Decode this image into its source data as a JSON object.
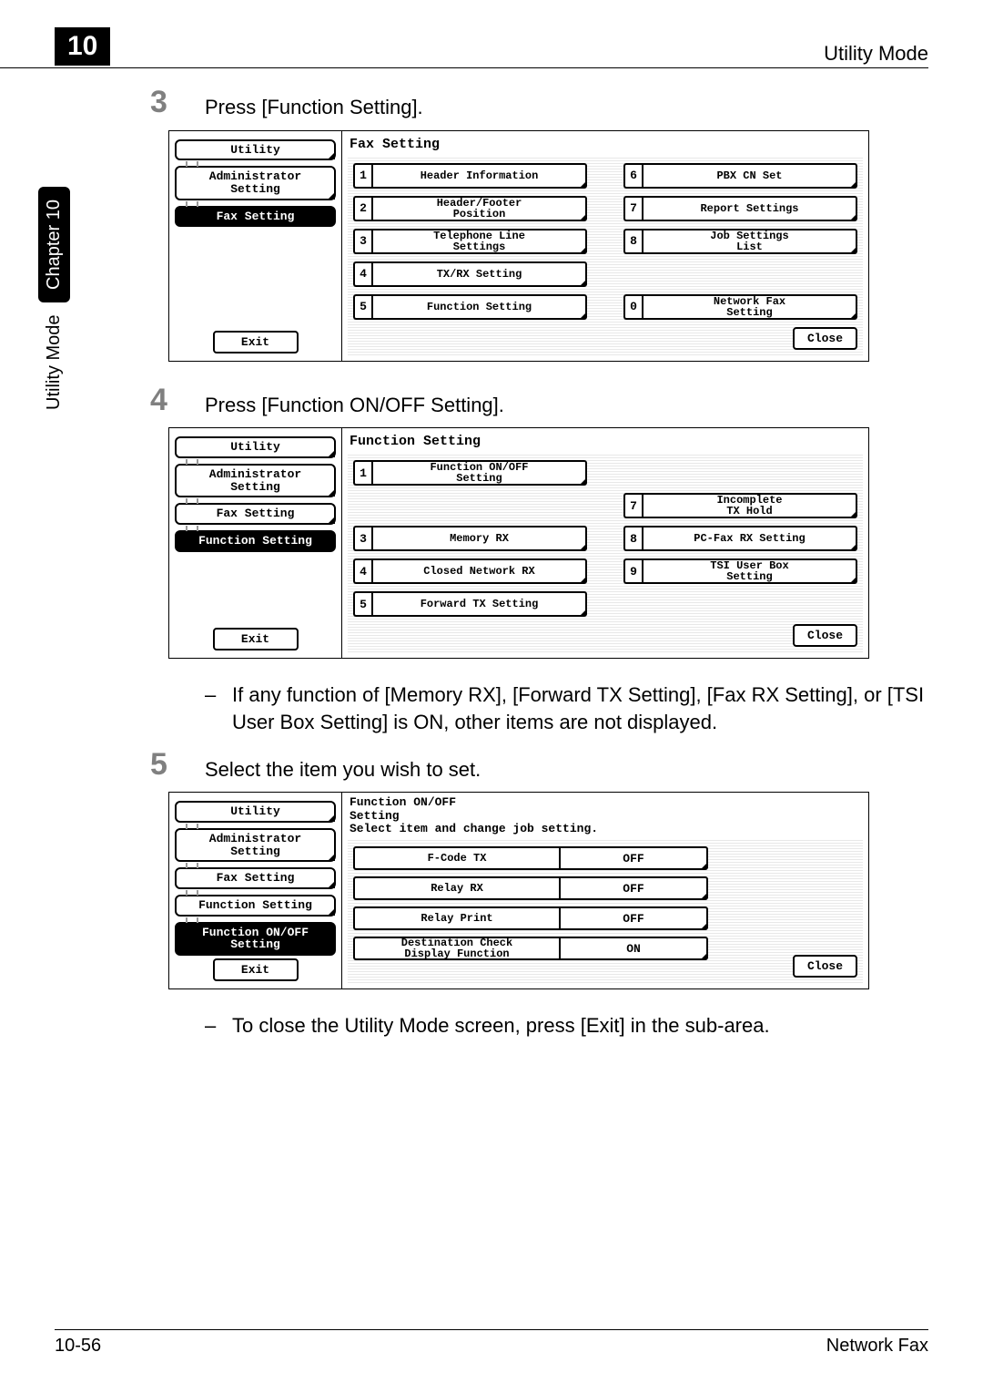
{
  "page": {
    "chapter_number": "10",
    "header_title": "Utility Mode",
    "side_label": "Utility Mode",
    "side_chapter": "Chapter 10",
    "footer_left": "10-56",
    "footer_right": "Network Fax"
  },
  "steps": {
    "s3": {
      "num": "3",
      "text": "Press [Function Setting]."
    },
    "s4": {
      "num": "4",
      "text": "Press [Function ON/OFF Setting]."
    },
    "note4": "If any function of [Memory RX], [Forward TX Setting], [Fax RX Setting], or [TSI User Box Setting] is ON, other items are not displayed.",
    "s5": {
      "num": "5",
      "text": "Select the item you wish to set."
    },
    "note5": "To close the Utility Mode screen, press [Exit] in the sub-area."
  },
  "screen1": {
    "title": "Fax Setting",
    "crumbs": [
      "Utility",
      "Administrator\nSetting",
      "Fax Setting"
    ],
    "exit": "Exit",
    "close": "Close",
    "opts": [
      {
        "n": "1",
        "label": "Header Information",
        "corner": true
      },
      {
        "n": "6",
        "label": "PBX CN Set",
        "corner": true
      },
      {
        "n": "2",
        "label": "Header/Footer\nPosition",
        "corner": true
      },
      {
        "n": "7",
        "label": "Report Settings",
        "corner": true
      },
      {
        "n": "3",
        "label": "Telephone Line\nSettings",
        "corner": true
      },
      {
        "n": "8",
        "label": "Job Settings\nList",
        "corner": true
      },
      {
        "n": "4",
        "label": "TX/RX Setting",
        "corner": true
      },
      {
        "n": "",
        "label": "",
        "empty": true
      },
      {
        "n": "5",
        "label": "Function Setting",
        "corner": true
      },
      {
        "n": "0",
        "label": "Network Fax\nSetting",
        "corner": true
      }
    ]
  },
  "screen2": {
    "title": "Function Setting",
    "crumbs": [
      "Utility",
      "Administrator\nSetting",
      "Fax Setting",
      "Function Setting"
    ],
    "exit": "Exit",
    "close": "Close",
    "opts": [
      {
        "n": "1",
        "label": "Function ON/OFF\nSetting",
        "corner": true
      },
      {
        "n": "",
        "label": "",
        "empty": true
      },
      {
        "n": "",
        "label": "",
        "empty": true
      },
      {
        "n": "7",
        "label": "Incomplete\nTX Hold",
        "corner": true
      },
      {
        "n": "3",
        "label": "Memory RX",
        "corner": true
      },
      {
        "n": "8",
        "label": "PC-Fax RX Setting",
        "corner": true
      },
      {
        "n": "4",
        "label": "Closed Network RX",
        "corner": true
      },
      {
        "n": "9",
        "label": "TSI User Box\nSetting",
        "corner": true
      },
      {
        "n": "5",
        "label": "Forward TX Setting",
        "corner": true
      },
      {
        "n": "",
        "label": "",
        "empty": true
      }
    ]
  },
  "screen3": {
    "title": "Function ON/OFF\nSetting",
    "subtitle": "Select item and change job setting.",
    "crumbs": [
      "Utility",
      "Administrator\nSetting",
      "Fax Setting",
      "Function Setting",
      "Function ON/OFF\nSetting"
    ],
    "exit": "Exit",
    "close": "Close",
    "rows": [
      {
        "label": "F-Code TX",
        "val": "OFF"
      },
      {
        "label": "Relay RX",
        "val": "OFF"
      },
      {
        "label": "Relay Print",
        "val": "OFF"
      },
      {
        "label": "Destination Check\nDisplay Function",
        "val": "ON"
      }
    ]
  }
}
